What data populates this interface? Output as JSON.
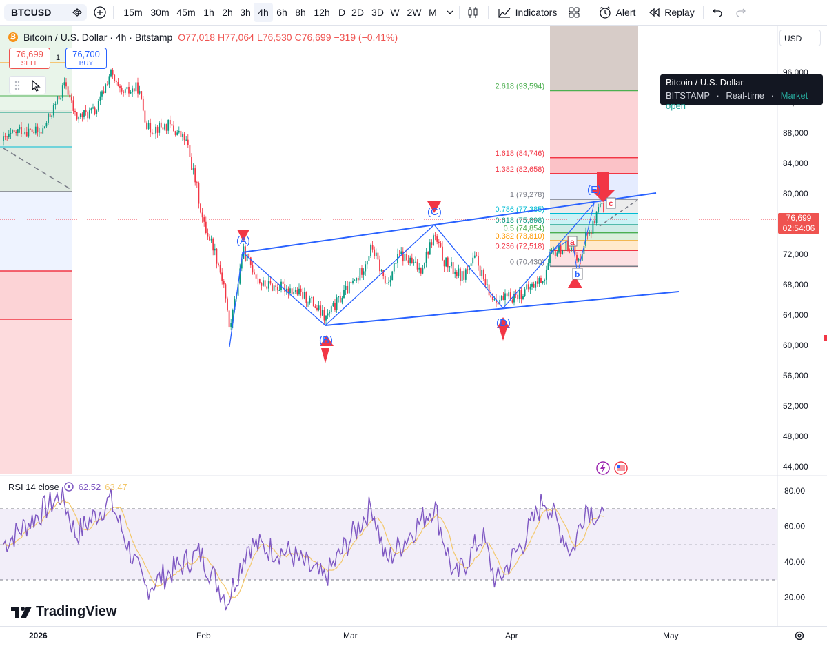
{
  "toolbar": {
    "symbol": "BTCUSD",
    "timeframes": [
      "15m",
      "30m",
      "45m",
      "1h",
      "2h",
      "3h",
      "4h",
      "6h",
      "8h",
      "12h",
      "D",
      "2D",
      "3D",
      "W",
      "2W",
      "M"
    ],
    "active_timeframe": "4h",
    "indicators_label": "Indicators",
    "alert_label": "Alert",
    "replay_label": "Replay"
  },
  "legend": {
    "title": "Bitcoin / U.S. Dollar · 4h · Bitstamp",
    "open": "O77,018",
    "high": "H77,064",
    "low": "L76,530",
    "close": "C76,699",
    "change": "−319 (−0.41%)"
  },
  "trade": {
    "sell_price": "76,699",
    "sell_label": "SELL",
    "spread": "1",
    "buy_price": "76,700",
    "buy_label": "BUY"
  },
  "tooltip": {
    "title": "Bitcoin / U.S. Dollar",
    "exchange": "BITSTAMP",
    "feed": "Real-time",
    "status": "Market open"
  },
  "currency": "USD",
  "last_price": {
    "value": "76,699",
    "countdown": "02:54:06"
  },
  "price_axis": [
    "96,000",
    "92,000",
    "88,000",
    "84,000",
    "80,000",
    "72,000",
    "68,000",
    "64,000",
    "60,000",
    "56,000",
    "52,000",
    "48,000",
    "44,000"
  ],
  "fib_levels": [
    {
      "label": "2.618 (93,594)",
      "price": 93594,
      "color": "#4caf50"
    },
    {
      "label": "1.618 (84,746)",
      "price": 84746,
      "color": "#f23645"
    },
    {
      "label": "1.382 (82,658)",
      "price": 82658,
      "color": "#f23645"
    },
    {
      "label": "1 (79,278)",
      "price": 79278,
      "color": "#787b86"
    },
    {
      "label": "0.786 (77,385)",
      "price": 77385,
      "color": "#00bcd4"
    },
    {
      "label": "0.618 (75,898)",
      "price": 75898,
      "color": "#089981"
    },
    {
      "label": "0.5 (74,854)",
      "price": 74854,
      "color": "#4caf50"
    },
    {
      "label": "0.382 (73,810)",
      "price": 73810,
      "color": "#ff9800"
    },
    {
      "label": "0.236 (72,518)",
      "price": 72518,
      "color": "#f23645"
    },
    {
      "label": "0 (70,430)",
      "price": 70430,
      "color": "#787b86"
    }
  ],
  "wave_labels": [
    "(A)",
    "(B)",
    "(C)",
    "(D)",
    "(E)",
    "a",
    "b",
    "c"
  ],
  "rsi": {
    "label": "RSI 14 close",
    "value": "62.52",
    "ma_value": "63.47",
    "axis": [
      "80.00",
      "60.00",
      "40.00",
      "20.00"
    ],
    "colors": {
      "line": "#7e57c2",
      "ma": "#f3c76a"
    }
  },
  "time_axis": [
    "2026",
    "Feb",
    "Mar",
    "Apr",
    "May"
  ],
  "brand": "TradingView",
  "colors": {
    "up": "#089981",
    "down": "#f23645",
    "pattern": "#2962ff",
    "marker": "#f23645"
  }
}
